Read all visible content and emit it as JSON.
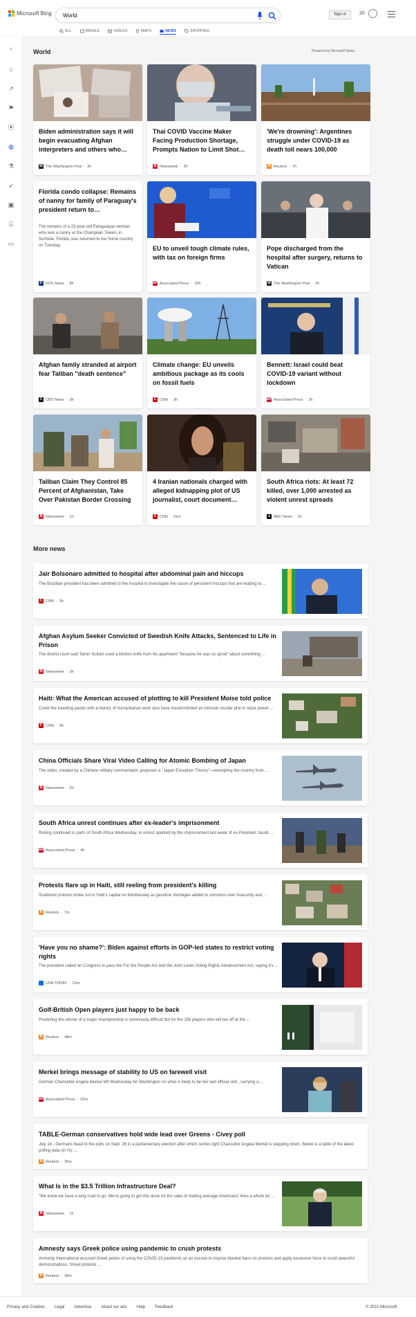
{
  "header": {
    "logo_text": "Microsoft Bing",
    "search_value": "World",
    "signin_label": "Sign in",
    "rewards_count": "20"
  },
  "tabs": [
    {
      "label": "ALL",
      "icon": "search-icon"
    },
    {
      "label": "IMAGES",
      "icon": "image-icon"
    },
    {
      "label": "VIDEOS",
      "icon": "video-icon"
    },
    {
      "label": "MAPS",
      "icon": "map-pin-icon"
    },
    {
      "label": "NEWS",
      "icon": "news-icon",
      "active": true
    },
    {
      "label": "SHOPPING",
      "icon": "tag-icon"
    }
  ],
  "section": {
    "title": "World",
    "powered": "Powered by Microsoft News",
    "more_title": "More news"
  },
  "cards": [
    {
      "title": "Biden administration says it will begin evacuating Afghan interpreters and others who…",
      "source": "The Washington Post",
      "time": "2h"
    },
    {
      "title": "Thai COVID Vaccine Maker Facing Production Shortage, Prompts Nation to Limit Shot…",
      "source": "Newsweek",
      "time": "2h"
    },
    {
      "title": "'We're drowning': Argentines struggle under COVID-19 as death toll nears 100,000",
      "source": "Reuters",
      "time": "7h"
    },
    {
      "title": "Florida condo collapse: Remains of nanny for family of Paraguay's president return to…",
      "desc": "The remains of a 23-year-old Paraguayan woman who was a nanny at the Champlain Towers in Surfside, Florida, was returned to her home country on Tuesday.",
      "source": "FOX News",
      "time": "8h"
    },
    {
      "title": "EU to unveil tough climate rules, with tax on foreign firms",
      "source": "Associated Press",
      "time": "10h"
    },
    {
      "title": "Pope discharged from the hospital after surgery, returns to Vatican",
      "source": "The Washington Post",
      "time": "2h"
    },
    {
      "title": "Afghan family stranded at airport fear Taliban \"death sentence\"",
      "source": "CBS News",
      "time": "3h"
    },
    {
      "title": "Climate change: EU unveils ambitious package as its cools on fossil fuels",
      "source": "CNN",
      "time": "3h"
    },
    {
      "title": "Bennett: Israel could beat COVID-19 variant without lockdown",
      "source": "Associated Press",
      "time": "2h"
    },
    {
      "title": "Taliban Claim They Control 85 Percent of Afghanistan, Take Over Pakistan Border Crossing",
      "source": "Newsweek",
      "time": "1h"
    },
    {
      "title": "4 Iranian nationals charged with alleged kidnapping plot of US journalist, court document…",
      "source": "CNN",
      "time": "31m"
    },
    {
      "title": "South Africa riots: At least 72 killed, over 1,000 arrested as violent unrest spreads",
      "source": "ABC News",
      "time": "1h"
    }
  ],
  "more_news": [
    {
      "title": "Jair Bolsonaro admitted to hospital after abdominal pain and hiccups",
      "desc": "The Brazilian president has been admitted to the hospital to investigate the cause of persistent hiccups that are leading to ...",
      "source": "CNN",
      "time": "3h"
    },
    {
      "title": "Afghan Asylum Seeker Convicted of Swedish Knife Attacks, Sentenced to Life in Prison",
      "desc": "The district court said Tamin Sultani used a kitchen knife from his apartment \"because he was so upset\" about something ...",
      "source": "Newsweek",
      "time": "2h"
    },
    {
      "title": "Haiti: What the American accused of plotting to kill President Moise told police",
      "desc": "Could the traveling pastor with a history of humanitarian work also have masterminded an intricate murder plot to seize power ...",
      "source": "CNN",
      "time": "9h"
    },
    {
      "title": "China Officials Share Viral Video Calling for Atomic Bombing of Japan",
      "desc": "The video, created by a Chinese military commentator, proposes a \"Japan Exception Theory\"—exempting the country from ...",
      "source": "Newsweek",
      "time": "2h"
    },
    {
      "title": "South Africa unrest continues after ex-leader's imprisonment",
      "desc": "Rioting continued in parts of South Africa Wednesday, in unrest sparked by the imprisonment last week of ex-President Jacob ...",
      "source": "Associated Press",
      "time": "4h"
    },
    {
      "title": "Protests flare up in Haiti, still reeling from president's killing",
      "desc": "Scattered protests broke out in Haiti's capital on Wednesday as gasoline shortages added to concerns over insecurity and ...",
      "source": "Reuters",
      "time": "7m"
    },
    {
      "title": "'Have you no shame?': Biden against efforts in GOP-led states to restrict voting rights",
      "desc": "The president called on Congress to pass the For the People Act and the John Lewis Voting Rights Advancement Act, saying it's ...",
      "source": "USA TODAY",
      "time": "23m"
    },
    {
      "title": "Golf-British Open players just happy to be back",
      "desc": "Predicting the winner of a major championship is notoriously difficult but for the 156 players who will tee off at the ...",
      "source": "Reuters",
      "time": "48m"
    },
    {
      "title": "Merkel brings message of stability to US on farewell visit",
      "desc": "German Chancellor Angela Merkel left Wednesday for Washington on what is likely to be her last official visit , carrying a ...",
      "source": "Associated Press",
      "time": "52m"
    },
    {
      "title": "TABLE-German conservatives hold wide lead over Greens - Civey poll",
      "desc": "July 14 - Germans head to the polls on Sept. 26 in a parliamentary election after which center-right Chancellor Angela Merkel is stepping down. Below is a table of the latest polling data (in %): ...",
      "source": "Reuters",
      "time": "35m"
    },
    {
      "title": "What Is in the $3.5 Trillion Infrastructure Deal?",
      "desc": "\"We know we have a long road to go. We're going to get this done for the sake of making average Americans' lives a whole lot ...",
      "source": "Newsweek",
      "time": "1h"
    },
    {
      "title": "Amnesty says Greek police using pandemic to crush protests",
      "desc": "Amnesty International accused Greek police of using the COVID-19 pandemic as an excuse to impose blanket bans on protests and apply excessive force to crush peaceful demonstrations. Street protests ...",
      "source": "Reuters",
      "time": "38m"
    }
  ],
  "footer": {
    "links": [
      "Privacy and Cookies",
      "Legal",
      "Advertise",
      "About our ads",
      "Help",
      "Feedback"
    ],
    "copyright": "© 2021 Microsoft"
  }
}
